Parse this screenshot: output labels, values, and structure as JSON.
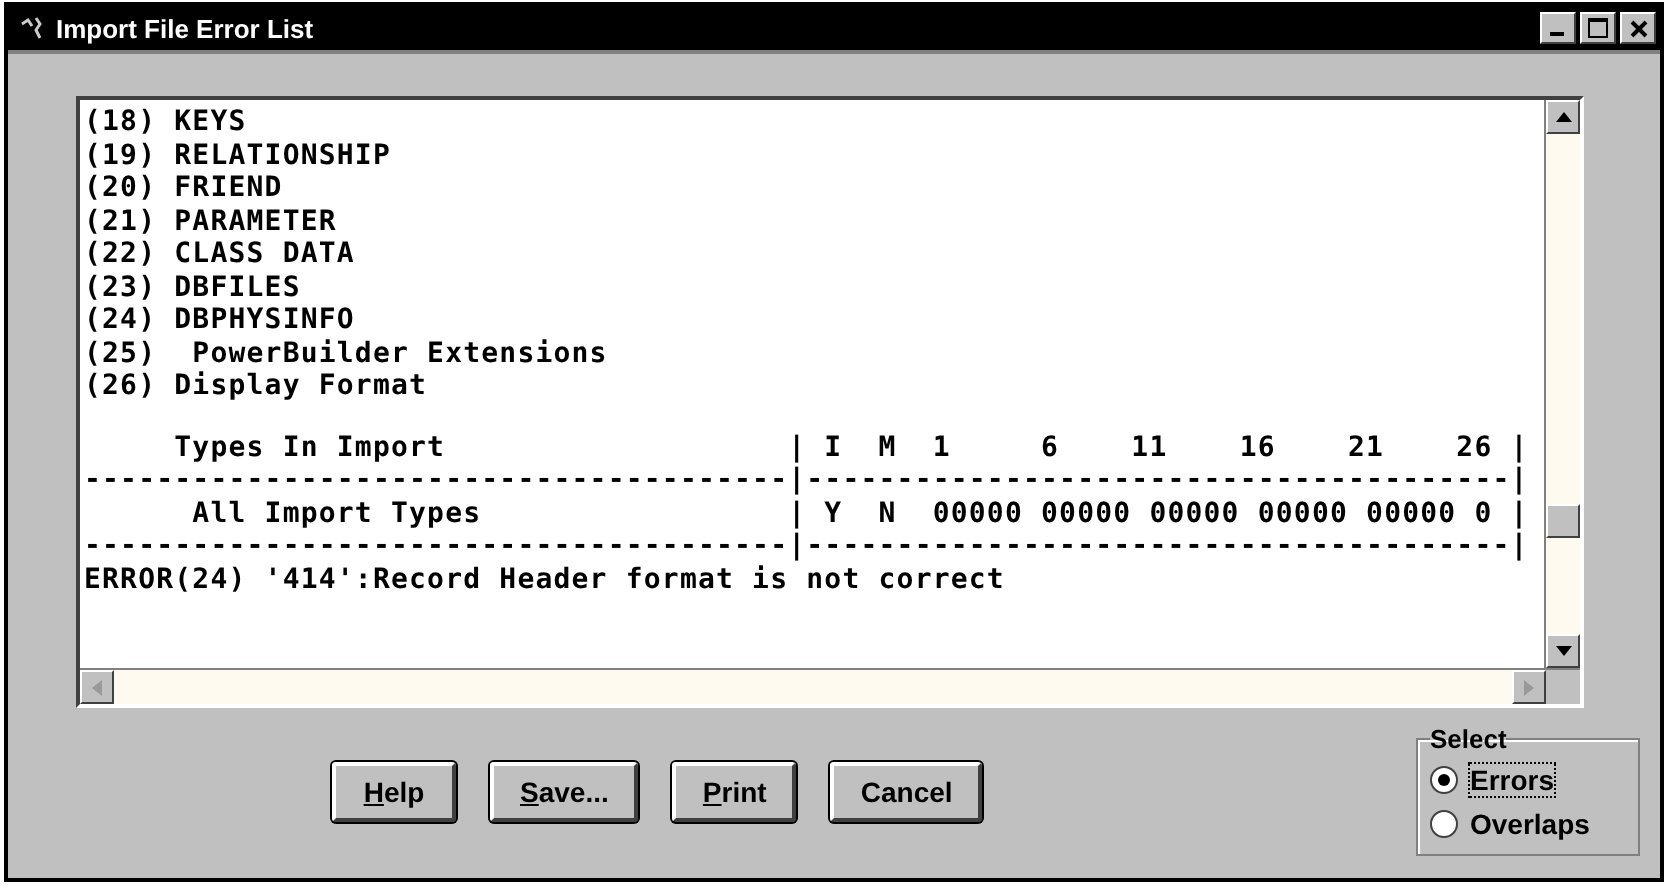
{
  "window": {
    "title": "Import File Error List"
  },
  "report_lines": [
    "(18) KEYS",
    "(19) RELATIONSHIP",
    "(20) FRIEND",
    "(21) PARAMETER",
    "(22) CLASS DATA",
    "(23) DBFILES",
    "(24) DBPHYSINFO",
    "(25)  PowerBuilder Extensions",
    "(26) Display Format"
  ],
  "table_lines": [
    "     Types In Import                   | I  M  1     6    11    16    21    26 |",
    "---------------------------------------|---------------------------------------|",
    "      All Import Types                 | Y  N  00000 00000 00000 00000 00000 0 |",
    "---------------------------------------|---------------------------------------|"
  ],
  "error_lines": [
    "ERROR(24) '414':Record Header format is not correct"
  ],
  "buttons": [
    {
      "label": "Help",
      "mnemonic_first": true
    },
    {
      "label": "Save...",
      "mnemonic_first": true
    },
    {
      "label": "Print",
      "mnemonic_first": true
    },
    {
      "label": "Cancel",
      "mnemonic_first": false
    }
  ],
  "select": {
    "title": "Select",
    "options": [
      {
        "label": "Errors",
        "selected": true
      },
      {
        "label": "Overlaps",
        "selected": false
      }
    ]
  }
}
